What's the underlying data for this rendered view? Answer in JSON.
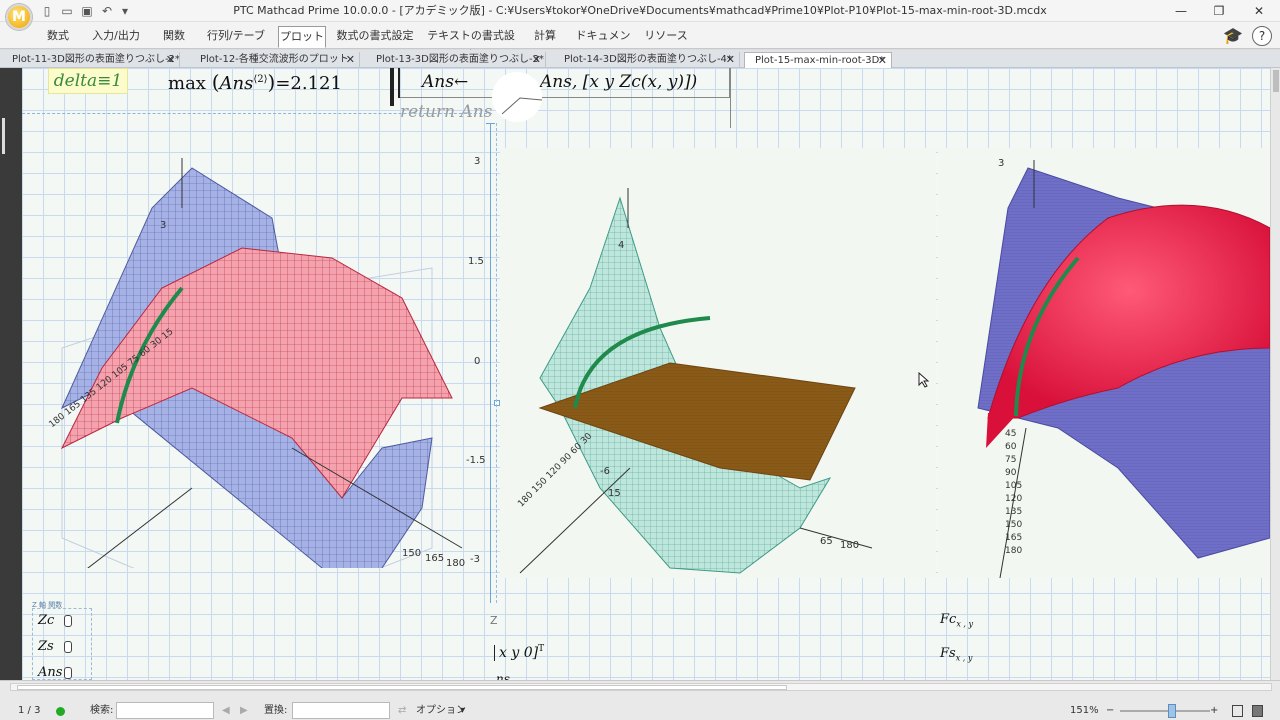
{
  "window": {
    "title": "PTC Mathcad Prime 10.0.0.0 - [アカデミック版] - C:¥Users¥tokor¥OneDrive¥Documents¥mathcad¥Prime10¥Plot-P10¥Plot-15-max-min-root-3D.mcdx",
    "logo": "M",
    "minimize": "—",
    "restore": "❐",
    "close": "✕"
  },
  "ribbon": {
    "tabs": [
      "数式",
      "入力/出力",
      "関数",
      "行列/テーブル",
      "プロット",
      "数式の書式設定",
      "テキストの書式設定",
      "計算",
      "ドキュメント",
      "リソース"
    ],
    "active_tab": "プロット",
    "help": "?"
  },
  "doc_tabs": [
    {
      "label": "Plot-11-3D図形の表面塗りつぶし-2*",
      "active": false
    },
    {
      "label": "Plot-12-各種交流波形のプロット",
      "active": false
    },
    {
      "label": "Plot-13-3D図形の表面塗りつぶし-3*",
      "active": false
    },
    {
      "label": "Plot-14-3D図形の表面塗りつぶし-4*",
      "active": false
    },
    {
      "label": "Plot-15-max-min-root-3D*",
      "active": true
    }
  ],
  "close_glyph": "✕",
  "math": {
    "delta": "delta≡1",
    "max_label": "max",
    "max_arg": "Ans",
    "max_sup": "⟨2⟩",
    "max_value": "=2.121",
    "ans_assign": "Ans←",
    "ans_rest": "Ans, [x  y  Zc(x, y)])",
    "return": "return Ans",
    "xy0": "x  y  0]",
    "xy0_sup": "T",
    "ans_frag": "ns",
    "fc": "Fc",
    "fs": "Fs",
    "sub_xy": "x , y"
  },
  "plot1": {
    "z_top": "3",
    "axis_ticks": [
      "0",
      "15",
      "30",
      "45",
      "60",
      "75",
      "90",
      "105",
      "120",
      "135",
      "150",
      "165",
      "180"
    ],
    "right_ticks": [
      "150",
      "165",
      "180"
    ]
  },
  "plot2": {
    "y_ticks": [
      "3",
      "1.5",
      "0",
      "-1.5",
      "-3"
    ],
    "z_top": "4",
    "z_low": "-6",
    "axis_ticks": [
      "0",
      "15",
      "30",
      "45",
      "60",
      "75",
      "90",
      "105",
      "120",
      "135",
      "150",
      "165",
      "180"
    ],
    "right_ticks": [
      "65",
      "180"
    ],
    "tick_15": "15",
    "label_z": "Z"
  },
  "plot3": {
    "z_top": "3",
    "axis_ticks": [
      "30",
      "45",
      "60",
      "75",
      "90",
      "105",
      "120",
      "135",
      "150",
      "165",
      "180"
    ]
  },
  "legend": {
    "title": "Z 軸",
    "sub": "関数",
    "items": [
      "Zc",
      "Zs",
      "Ans"
    ]
  },
  "status": {
    "page": "1 / 3",
    "search_label": "検索:",
    "search_value": "",
    "replace_label": "置換:",
    "replace_value": "",
    "options_label": "オプション",
    "zoom": "151%",
    "zoom_minus": "−",
    "zoom_plus": "+"
  },
  "colors": {
    "blue_mesh": "#7f8fd9",
    "red_mesh": "#e8536e",
    "teal_mesh": "#7fcfbf",
    "brown_plane": "#8a5a18",
    "green_curve": "#1f8a4c"
  }
}
